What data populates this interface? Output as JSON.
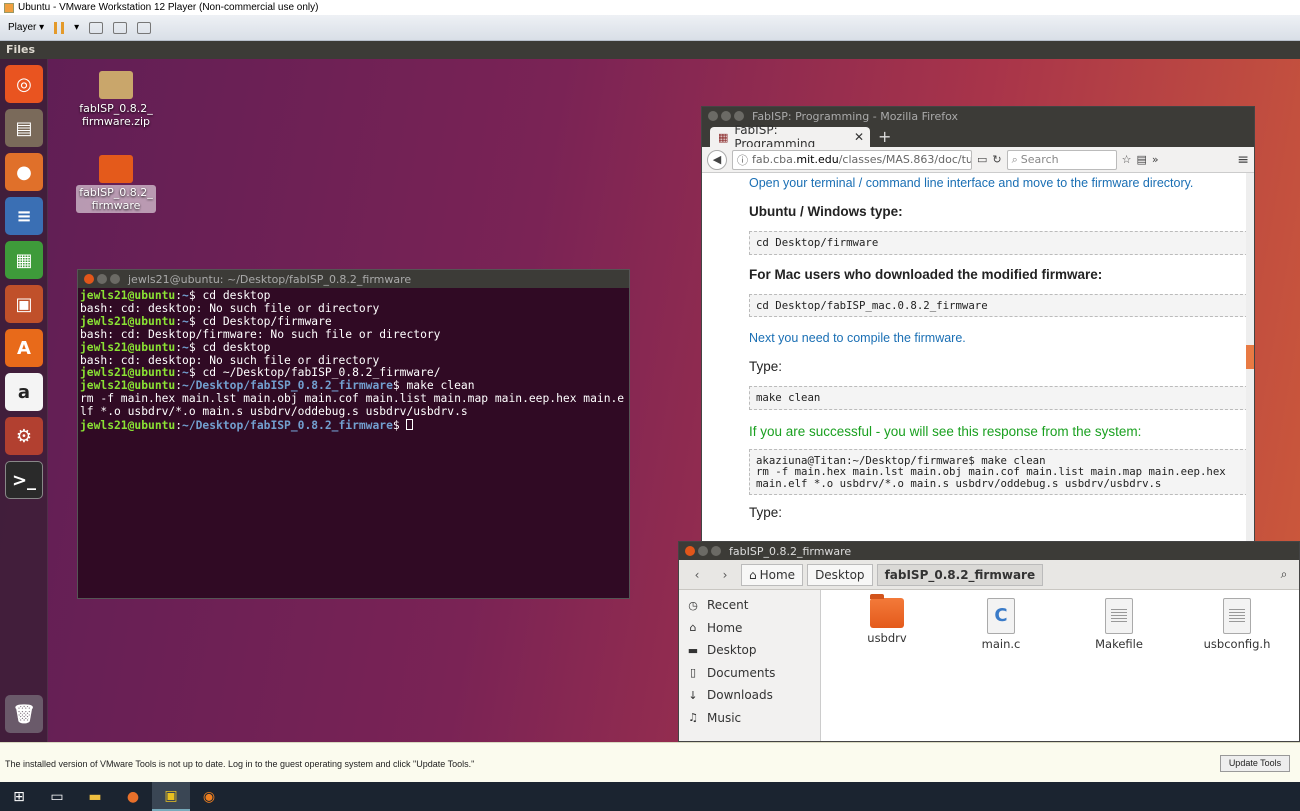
{
  "vmware": {
    "title": "Ubuntu - VMware Workstation 12 Player (Non-commercial use only)",
    "player_menu": "Player ▾",
    "notification": "The installed version of VMware Tools is not up to date. Log in to the guest operating system and click \"Update Tools.\"",
    "update_tools_button": "Update Tools"
  },
  "ubuntu": {
    "top_panel_title": "Files",
    "desktop_icons": [
      {
        "label": "fabISP_0.8.2_ firmware.zip"
      },
      {
        "label": "fabISP_0.8.2_ firmware"
      }
    ]
  },
  "terminal": {
    "title": "jewls21@ubuntu: ~/Desktop/fabISP_0.8.2_firmware",
    "lines": [
      {
        "user": "jewls21@ubuntu",
        "path": "~",
        "cmd": "$ cd desktop"
      },
      {
        "text": "bash: cd: desktop: No such file or directory"
      },
      {
        "user": "jewls21@ubuntu",
        "path": "~",
        "cmd": "$ cd Desktop/firmware"
      },
      {
        "text": "bash: cd: Desktop/firmware: No such file or directory"
      },
      {
        "user": "jewls21@ubuntu",
        "path": "~",
        "cmd": "$ cd desktop"
      },
      {
        "text": "bash: cd: desktop: No such file or directory"
      },
      {
        "user": "jewls21@ubuntu",
        "path": "~",
        "cmd": "$ cd ~/Desktop/fabISP_0.8.2_firmware/"
      },
      {
        "user": "jewls21@ubuntu",
        "path": "~/Desktop/fabISP_0.8.2_firmware",
        "cmd": "$ make clean"
      },
      {
        "text": "rm -f main.hex main.lst main.obj main.cof main.list main.map main.eep.hex main.e"
      },
      {
        "text": "lf *.o usbdrv/*.o main.s usbdrv/oddebug.s usbdrv/usbdrv.s"
      },
      {
        "user": "jewls21@ubuntu",
        "path": "~/Desktop/fabISP_0.8.2_firmware",
        "cmd": "$ "
      }
    ]
  },
  "firefox": {
    "window_title": "FabISP: Programming - Mozilla Firefox",
    "tab_label": "FabISP: Programming",
    "url_prefix": "fab.cba.",
    "url_domain": "mit.edu",
    "url_rest": "/classes/MAS.863/doc/tu",
    "search_placeholder": "Search",
    "content": {
      "intro": "Open your terminal / command line interface and move to the firmware directory.",
      "ubuntu_heading": "Ubuntu / Windows type:",
      "ubuntu_code": "cd Desktop/firmware",
      "mac_heading": "For Mac users who downloaded the modified firmware:",
      "mac_code": "cd Desktop/fabISP_mac.0.8.2_firmware",
      "compile_text": "Next you need to compile the firmware.",
      "type_label": "Type:",
      "make_code": "make clean",
      "success_text": "If you are successful - you will see this response from the system:",
      "response_code": "akaziuna@Titan:~/Desktop/firmware$ make clean\nrm -f main.hex main.lst main.obj main.cof main.list main.map main.eep.hex\nmain.elf *.o usbdrv/*.o main.s usbdrv/oddebug.s usbdrv/usbdrv.s",
      "type_label_2": "Type:"
    }
  },
  "files": {
    "window_title": "fabISP_0.8.2_firmware",
    "breadcrumbs": [
      "Home",
      "Desktop",
      "fabISP_0.8.2_firmware"
    ],
    "sidebar": [
      "Recent",
      "Home",
      "Desktop",
      "Documents",
      "Downloads",
      "Music"
    ],
    "items": [
      {
        "name": "usbdrv",
        "type": "folder"
      },
      {
        "name": "main.c",
        "type": "c-source"
      },
      {
        "name": "Makefile",
        "type": "text"
      },
      {
        "name": "usbconfig.h",
        "type": "text"
      }
    ]
  },
  "colors": {
    "ubuntu_orange": "#e95420",
    "terminal_bg": "#300a24",
    "prompt_green": "#8ae234",
    "prompt_blue": "#729fcf",
    "link_blue": "#1a6fb4",
    "success_green": "#1aa020"
  }
}
